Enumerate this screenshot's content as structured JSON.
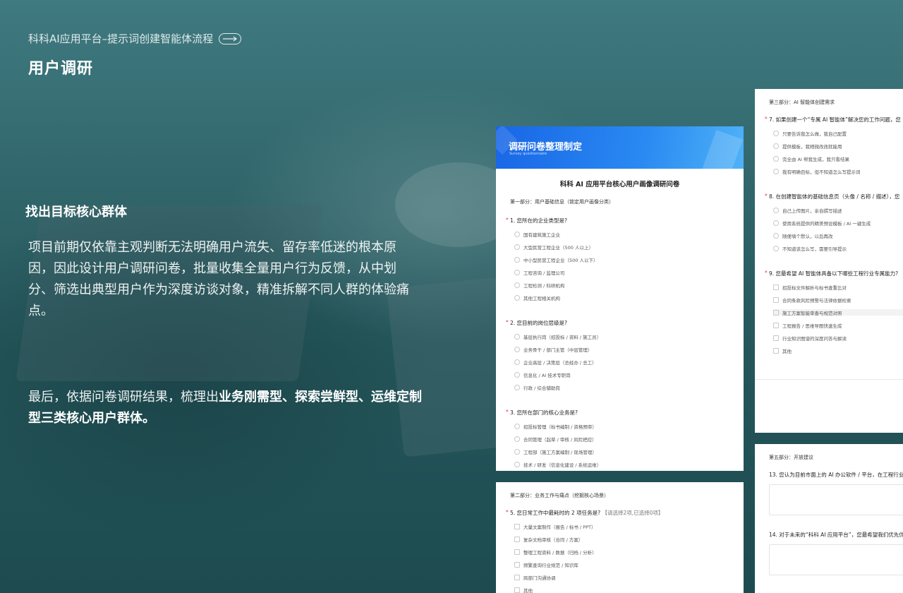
{
  "header": {
    "breadcrumb": "科科AI应用平台–提示词创建智能体流程",
    "title": "用户调研"
  },
  "section": {
    "heading": "找出目标核心群体",
    "body": "项目前期仅依靠主观判断无法明确用户流失、留存率低迷的根本原因，因此设计用户调研问卷，批量收集全量用户行为反馈，从中划分、筛选出典型用户作为深度访谈对象，精准拆解不同人群的体验痛点。",
    "conclusion_prefix": "最后，依据问卷调研结果，梳理出",
    "conclusion_bold": "业务刚需型、探索尝鲜型、运维定制型三类核心用户群体。"
  },
  "survey": {
    "banner_title": "调研问卷整理制定",
    "banner_sub": "Survey questionnaire",
    "title": "科科 AI 应用平台核心用户画像调研问卷",
    "part1": "第一部分：用户基础信息（锁定用户画像分类）",
    "q1": "1. 您所在的企业类型是?",
    "q1_options": [
      "国有建筑施工企业",
      "大型民营工程企业（500 人以上）",
      "中小型民营工程企业（500 人以下）",
      "工程咨询 / 监理公司",
      "工程检测 / 科研机构",
      "其他工程相关机构"
    ],
    "q2": "2. 您目前的岗位层级是?",
    "q2_options": [
      "基层执行岗（招投标 / 资料 / 施工员）",
      "业务骨干 / 部门主管（中层管理）",
      "企业高层 / 决策层（总经办 / 总工）",
      "信息化 / AI 技术专职岗",
      "行政 / 综合辅助岗"
    ],
    "q3": "3. 您所在部门的核心业务是?",
    "q3_options": [
      "招投标管理（标书编制 / 资格预审）",
      "合同管理（起草 / 审核 / 风险把控）",
      "工程部（施工方案编制 / 现场管理）",
      "技术 / 研发（信息化建设 / 系统运维）"
    ],
    "part2": "第二部分：业务工作与痛点（挖掘核心场景）",
    "q5": "5. 您日常工作中最耗时的 2 项任务是?",
    "q5_hint": "【请选择2项,已选择0项】",
    "q5_options": [
      "大量文案制作（报告 / 标书 / PPT）",
      "复杂文档审核（合同 / 方案）",
      "整理工程资料 / 数据（归档 / 分析）",
      "频繁查询行业规范 / 知识库",
      "跨部门沟通协调",
      "其他"
    ],
    "part3": "第三部分：AI 智能体创建需求",
    "q7": "7. 如果创建一个“专属 AI 智能体”解决您的工作问题，您",
    "q7_options": [
      "只要告诉我怎么做，我自己配置",
      "提供模板，我稍微改改就能用",
      "完全由 AI 帮我生成，我只看结果",
      "我有明确目标，但不知道怎么写提示词"
    ],
    "q8": "8. 在创建智能体的基础信息页（头像 / 名称 / 描述），您",
    "q8_options": [
      "自己上传图片，亲自撰写描述",
      "使用系统提供的精美预设模板 / AI 一键生成",
      "随便填个默认，以后再改",
      "不知道该怎么写，需要引导提示"
    ],
    "q9": "9. 您最希望 AI 智能体具备以下哪些工程行业专属能力?",
    "q9_options": [
      "招投标文件解析与标书查重比对",
      "合同条款风险预警与法律依据检索",
      "施工方案智能审查与规范对照",
      "工程报告 / 思维导图快速生成",
      "行业知识图谱的深度问答与解读",
      "其他"
    ],
    "part5": "第五部分：开放建议",
    "q13": "13. 您认为目前市面上的 AI 办公软件 / 平台，在工程行业",
    "q14": "14. 对于未来的“科科 AI 应用平台”，您最希望我们优先优"
  }
}
